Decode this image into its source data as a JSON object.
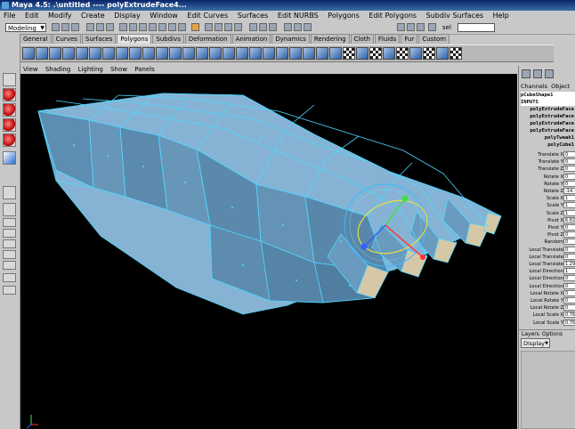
{
  "window": {
    "title": "Maya 4.5: .\\untitled  ----  polyExtrudeFace4..."
  },
  "menubar": [
    "File",
    "Edit",
    "Modify",
    "Create",
    "Display",
    "Window",
    "Edit Curves",
    "Surfaces",
    "Edit NURBS",
    "Polygons",
    "Edit Polygons",
    "Subdiv Surfaces",
    "Help"
  ],
  "status": {
    "mode": "Modeling",
    "input_label": "sel",
    "input_value": ""
  },
  "shelf": {
    "tabs": [
      "General",
      "Curves",
      "Surfaces",
      "Polygons",
      "Subdivs",
      "Deformation",
      "Animation",
      "Dynamics",
      "Rendering",
      "Cloth",
      "Fluids",
      "Fur",
      "Custom"
    ],
    "active_tab": "Polygons",
    "icon_count": 33
  },
  "viewport": {
    "menu": [
      "View",
      "Shading",
      "Lighting",
      "Show",
      "Panels"
    ]
  },
  "channelbox": {
    "tabs": [
      "Channels",
      "Object"
    ],
    "objects": [
      "pCubeShape1",
      "INPUTS",
      "polyExtrudeFace",
      "polyExtrudeFace",
      "polyExtrudeFace",
      "polyExtrudeFace",
      "polyTweak1",
      "polyCube1"
    ],
    "attributes": [
      {
        "label": "Translate X",
        "value": "0"
      },
      {
        "label": "Translate Y",
        "value": "0"
      },
      {
        "label": "Translate Z",
        "value": "0"
      },
      {
        "label": "Rotate X",
        "value": "0"
      },
      {
        "label": "Rotate Y",
        "value": "0"
      },
      {
        "label": "Rotate Z",
        "value": "-14."
      },
      {
        "label": "Scale X",
        "value": "1"
      },
      {
        "label": "Scale Y",
        "value": "1"
      },
      {
        "label": "Scale Z",
        "value": "1"
      },
      {
        "label": "Pivot X",
        "value": "6.82"
      },
      {
        "label": "Pivot Y",
        "value": "0"
      },
      {
        "label": "Pivot Z",
        "value": "0"
      },
      {
        "label": "Random",
        "value": "0"
      },
      {
        "label": "Local Translate",
        "value": "0"
      },
      {
        "label": "Local Translate",
        "value": "0"
      },
      {
        "label": "Local Translate",
        "value": "1.29"
      },
      {
        "label": "Local Direction",
        "value": "1"
      },
      {
        "label": "Local Direction",
        "value": "0"
      },
      {
        "label": "Local Direction",
        "value": "0"
      },
      {
        "label": "Local Rotate X",
        "value": "0"
      },
      {
        "label": "Local Rotate Y",
        "value": "0"
      },
      {
        "label": "Local Rotate Z",
        "value": "0"
      },
      {
        "label": "Local Scale X",
        "value": "0.76"
      },
      {
        "label": "Local Scale Y",
        "value": "0.76"
      }
    ]
  },
  "layers": {
    "menu": [
      "Layers",
      "Options"
    ],
    "display": "Display"
  },
  "colors": {
    "mesh_fill": "#82aed0",
    "mesh_edge": "#4fd6ff",
    "background": "#000000",
    "ui_gray": "#c8c8c8"
  }
}
